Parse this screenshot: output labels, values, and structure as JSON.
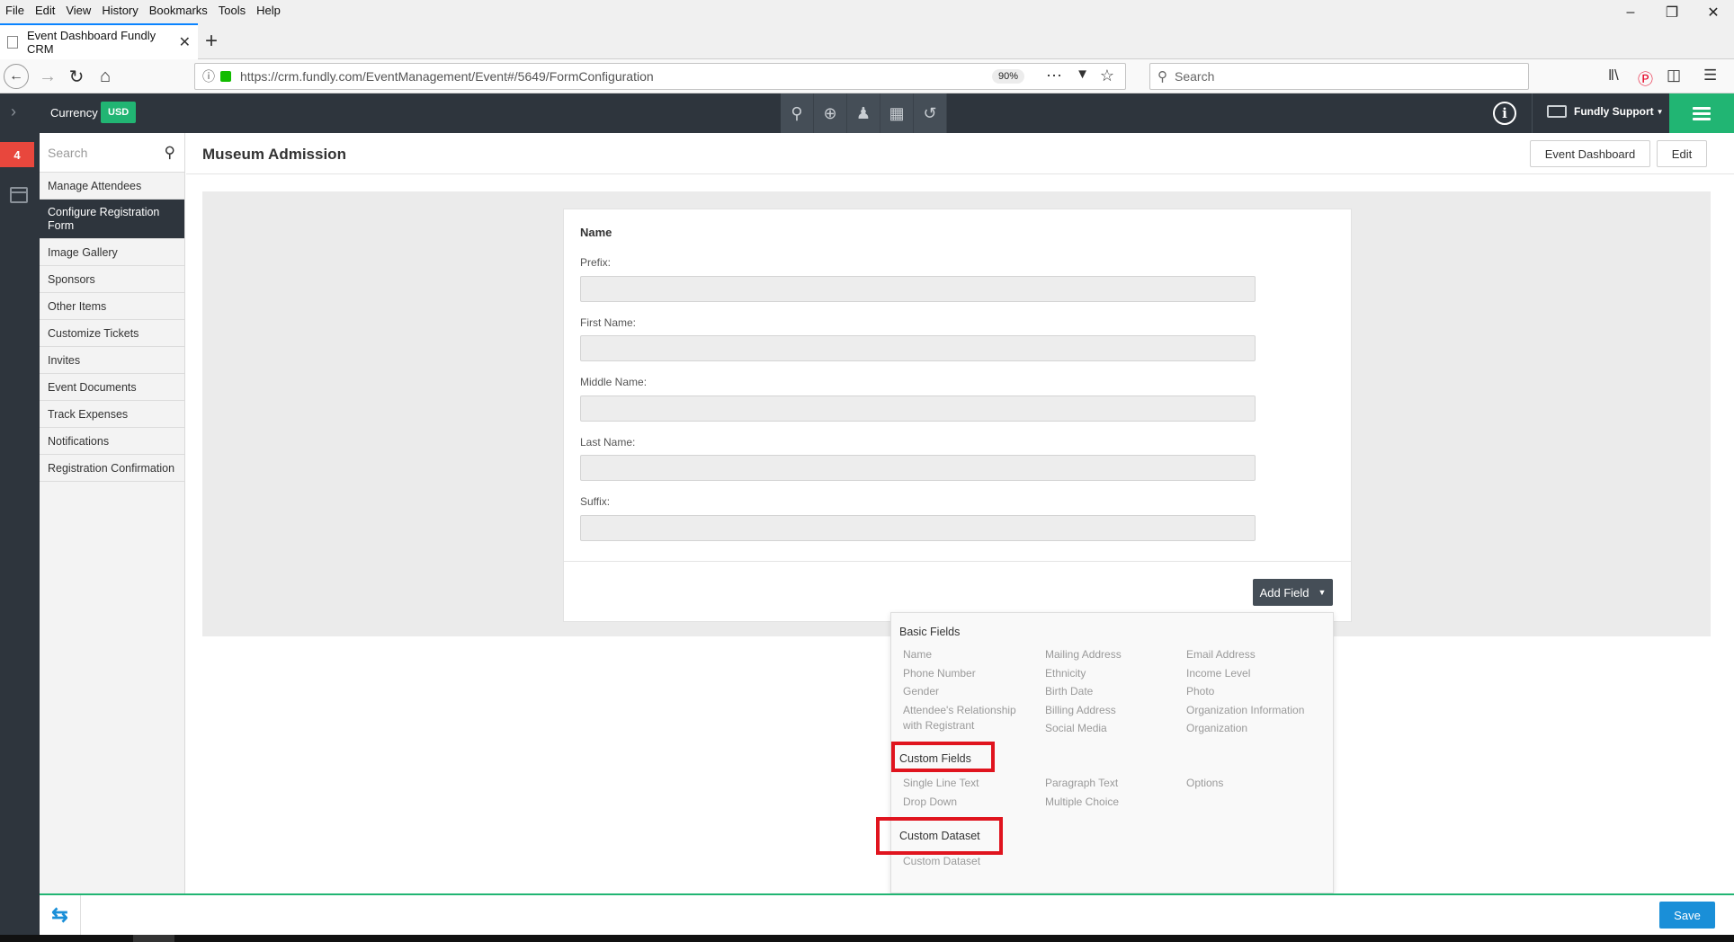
{
  "browser": {
    "menu": [
      "File",
      "Edit",
      "View",
      "History",
      "Bookmarks",
      "Tools",
      "Help"
    ],
    "tab_title": "Event Dashboard Fundly CRM",
    "url": "https://crm.fundly.com/EventManagement/Event#/5649/FormConfiguration",
    "zoom": "90%",
    "search_placeholder": "Search",
    "accent": "#0a84ff"
  },
  "header": {
    "currency_label": "Currency",
    "currency_value": "USD",
    "user_name": "Fundly Support",
    "colors": {
      "bar": "#2e353d",
      "green": "#21b573"
    }
  },
  "rail": {
    "badge_count": "4"
  },
  "sidebar": {
    "search_placeholder": "Search",
    "items": [
      {
        "label": "Manage Attendees"
      },
      {
        "label": "Configure Registration Form",
        "active": true
      },
      {
        "label": "Image Gallery"
      },
      {
        "label": "Sponsors"
      },
      {
        "label": "Other Items"
      },
      {
        "label": "Customize Tickets"
      },
      {
        "label": "Invites"
      },
      {
        "label": "Event Documents"
      },
      {
        "label": "Track Expenses"
      },
      {
        "label": "Notifications"
      },
      {
        "label": "Registration Confirmation"
      }
    ]
  },
  "page": {
    "title": "Museum Admission",
    "event_dashboard_label": "Event Dashboard",
    "edit_label": "Edit"
  },
  "form": {
    "section_title": "Name",
    "fields": [
      {
        "label": "Prefix:",
        "value": ""
      },
      {
        "label": "First Name:",
        "value": ""
      },
      {
        "label": "Middle Name:",
        "value": ""
      },
      {
        "label": "Last Name:",
        "value": ""
      },
      {
        "label": "Suffix:",
        "value": ""
      }
    ],
    "add_field_label": "Add Field"
  },
  "dropdown": {
    "basic_title": "Basic Fields",
    "basic": {
      "col1": [
        "Name",
        "Phone Number",
        "Gender",
        "Attendee's Relationship with Registrant"
      ],
      "col2": [
        "Mailing Address",
        "Ethnicity",
        "Birth Date",
        "Billing Address",
        "Social Media"
      ],
      "col3": [
        "Email Address",
        "Income Level",
        "Photo",
        "Organization Information",
        "Organization"
      ]
    },
    "custom_title": "Custom Fields",
    "custom": {
      "col1": [
        "Single Line Text",
        "Drop Down"
      ],
      "col2": [
        "Paragraph Text",
        "Multiple Choice"
      ],
      "col3": [
        "Options"
      ]
    },
    "dataset_title": "Custom Dataset",
    "dataset": [
      "Custom Dataset"
    ],
    "highlight_color": "#e0141e"
  },
  "footer": {
    "save_label": "Save",
    "save_color": "#1a8fd8"
  }
}
